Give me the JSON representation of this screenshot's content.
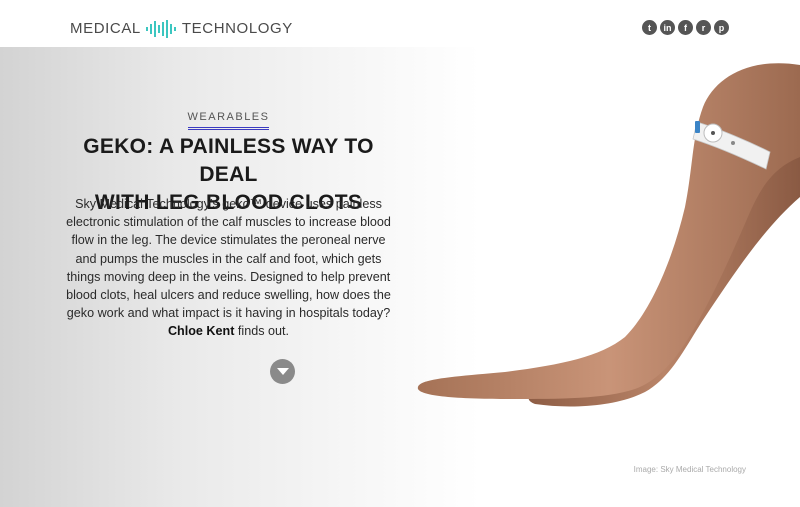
{
  "brand": {
    "left": "MEDICAL",
    "right": "TECHNOLOGY",
    "logo_icon": "dna-bars-icon",
    "accent": "#3cc6c0"
  },
  "social": [
    {
      "name": "twitter-icon",
      "glyph": "t"
    },
    {
      "name": "linkedin-icon",
      "glyph": "in"
    },
    {
      "name": "facebook-icon",
      "glyph": "f"
    },
    {
      "name": "reddit-icon",
      "glyph": "r"
    },
    {
      "name": "pinterest-icon",
      "glyph": "p"
    }
  ],
  "article": {
    "tag": "WEARABLES",
    "headline_line1": "GEKO: A PAINLESS WAY TO DEAL",
    "headline_line2": "WITH LEG BLOOD CLOTS",
    "intro": "Sky Medical Technology’s geko™ device uses painless electronic stimulation of the calf muscles to increase blood flow in the leg. The device stimulates the peroneal nerve and pumps the muscles in the calf and foot, which gets things moving deep in the veins. Designed to help prevent blood clots, heal ulcers and reduce swelling, how does the geko work and what impact is it having in hospitals today?",
    "author": "Chloe Kent",
    "intro_suffix": "finds out.",
    "scroll_icon": "chevron-down-icon"
  },
  "image_credit": "Image: Sky Medical Technology"
}
